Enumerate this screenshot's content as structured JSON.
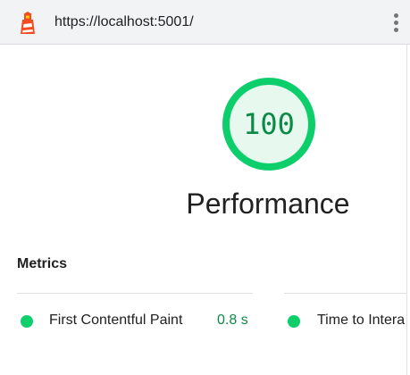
{
  "header": {
    "url": "https://localhost:5001/",
    "logo_icon": "lighthouse-icon",
    "menu_icon": "vertical-dots-menu-icon"
  },
  "gauge": {
    "score": "100",
    "score_fraction": 1.0,
    "color": "#0cce6b",
    "fill_color": "#e7f8ee",
    "text_color": "#0a8a46"
  },
  "category": {
    "title": "Performance"
  },
  "metrics": {
    "heading": "Metrics",
    "items": [
      {
        "label": "First Contentful Paint",
        "value": "0.8 s",
        "status_color": "#0cce6b",
        "icon": "pass-circle-icon"
      },
      {
        "label": "Time to Intera",
        "value": "",
        "status_color": "#0cce6b",
        "icon": "pass-circle-icon"
      }
    ]
  }
}
